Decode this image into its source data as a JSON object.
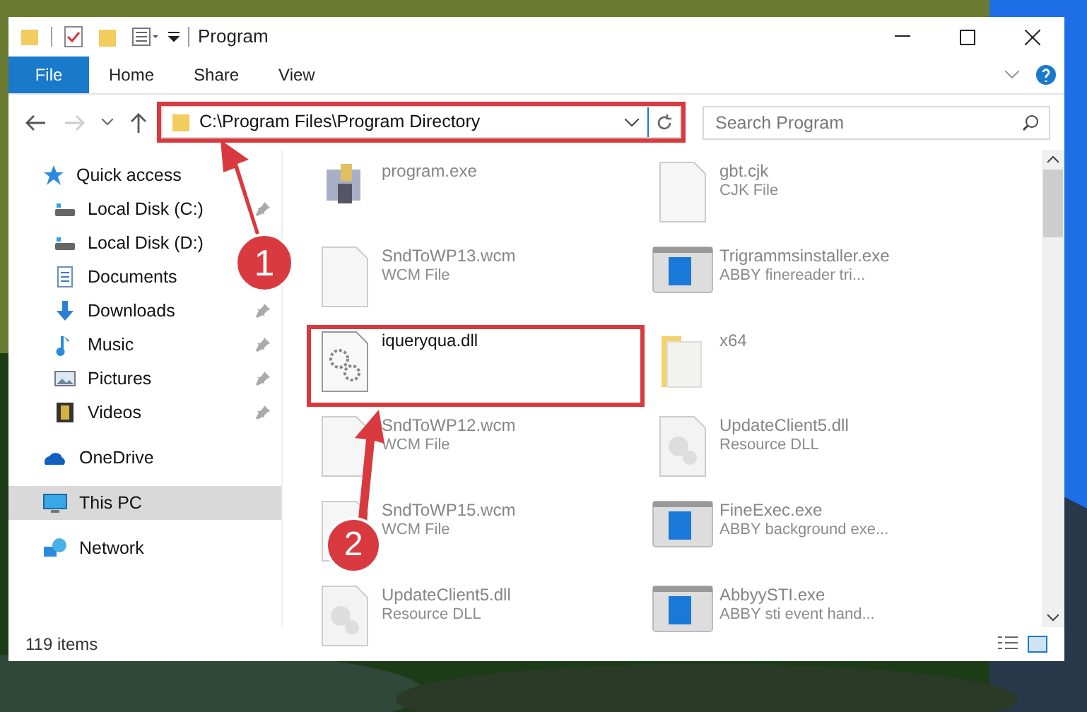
{
  "window": {
    "title": "Program"
  },
  "ribbon_tabs": [
    {
      "label": "File",
      "kind": "file"
    },
    {
      "label": "Home",
      "kind": "tab"
    },
    {
      "label": "Share",
      "kind": "tab"
    },
    {
      "label": "View",
      "kind": "tab"
    }
  ],
  "address": {
    "path": "C:\\Program Files\\Program Directory",
    "highlighted": true,
    "search_placeholder": "Search Program"
  },
  "sidebar": {
    "sections": [
      {
        "label": "Quick access",
        "kind": "star",
        "selected": false,
        "children": [
          {
            "label": "Local Disk (C:)",
            "kind": "disk",
            "pinned": true,
            "selected": false
          },
          {
            "label": "Local Disk (D:)",
            "kind": "disk",
            "pinned": false,
            "selected": false
          },
          {
            "label": "Documents",
            "kind": "doc",
            "pinned": false,
            "selected": false
          },
          {
            "label": "Downloads",
            "kind": "download",
            "pinned": true,
            "selected": false
          },
          {
            "label": "Music",
            "kind": "music",
            "pinned": true,
            "selected": false
          },
          {
            "label": "Pictures",
            "kind": "pictures",
            "pinned": true,
            "selected": false
          },
          {
            "label": "Videos",
            "kind": "video",
            "pinned": true,
            "selected": false
          }
        ]
      },
      {
        "label": "OneDrive",
        "kind": "cloud",
        "selected": false
      },
      {
        "label": "This PC",
        "kind": "pc",
        "selected": true
      },
      {
        "label": "Network",
        "kind": "network",
        "selected": false
      }
    ]
  },
  "files": [
    {
      "name": "program.exe",
      "kind": "installer",
      "faded": true,
      "highlighted": false
    },
    {
      "name": "gbt.cjk",
      "type": "CJK File",
      "kind": "blank",
      "faded": true,
      "highlighted": false
    },
    {
      "name": "SndToWP13.wcm",
      "type": "WCM File",
      "kind": "blank",
      "faded": true,
      "highlighted": false
    },
    {
      "name": "Trigrammsinstaller.exe",
      "type": "ABBY finereader tri...",
      "kind": "app",
      "faded": true,
      "highlighted": false
    },
    {
      "name": "iqueryqua.dll",
      "kind": "gear",
      "faded": false,
      "highlighted": true
    },
    {
      "name": "x64",
      "kind": "folder",
      "faded": true,
      "highlighted": false
    },
    {
      "name": "SndToWP12.wcm",
      "type": "WCM File",
      "kind": "blank",
      "faded": true,
      "highlighted": false
    },
    {
      "name": "UpdateClient5.dll",
      "type": "Resource DLL",
      "kind": "dll",
      "faded": true,
      "highlighted": false
    },
    {
      "name": "SndToWP15.wcm",
      "type": "WCM File",
      "kind": "blank",
      "faded": true,
      "highlighted": false
    },
    {
      "name": "FineExec.exe",
      "type": "ABBY background exe...",
      "kind": "app",
      "faded": true,
      "highlighted": false
    },
    {
      "name": "UpdateClient5.dll",
      "type": "Resource DLL",
      "kind": "dll",
      "faded": true,
      "highlighted": false
    },
    {
      "name": "AbbyySTI.exe",
      "type": "ABBY sti event hand...",
      "kind": "app",
      "faded": true,
      "highlighted": false
    }
  ],
  "status_bar": {
    "count": "119 items"
  },
  "annotations": [
    {
      "number": "1"
    },
    {
      "number": "2"
    }
  ]
}
